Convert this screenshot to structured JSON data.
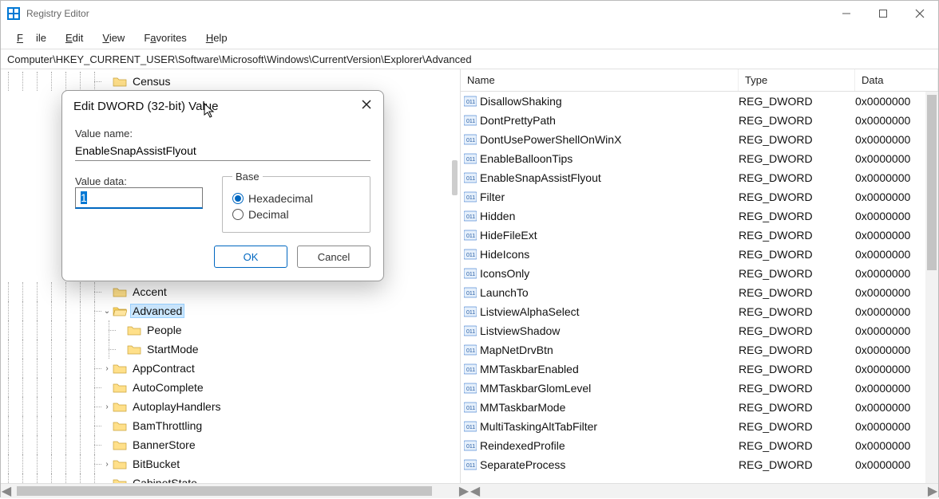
{
  "window": {
    "title": "Registry Editor"
  },
  "menu": {
    "file": "File",
    "edit": "Edit",
    "view": "View",
    "favorites": "Favorites",
    "help": "Help"
  },
  "addressbar": "Computer\\HKEY_CURRENT_USER\\Software\\Microsoft\\Windows\\CurrentVersion\\Explorer\\Advanced",
  "tree": {
    "items": [
      {
        "indent": 7,
        "exp": "",
        "label": "Census"
      },
      {
        "indent": 7,
        "exp": "",
        "label": "Accent"
      },
      {
        "indent": 7,
        "exp": "v",
        "label": "Advanced",
        "selected": true,
        "open": true
      },
      {
        "indent": 8,
        "exp": "",
        "label": "People"
      },
      {
        "indent": 8,
        "exp": "",
        "label": "StartMode"
      },
      {
        "indent": 7,
        "exp": ">",
        "label": "AppContract"
      },
      {
        "indent": 7,
        "exp": "",
        "label": "AutoComplete"
      },
      {
        "indent": 7,
        "exp": ">",
        "label": "AutoplayHandlers"
      },
      {
        "indent": 7,
        "exp": "",
        "label": "BamThrottling"
      },
      {
        "indent": 7,
        "exp": "",
        "label": "BannerStore"
      },
      {
        "indent": 7,
        "exp": ">",
        "label": "BitBucket"
      },
      {
        "indent": 7,
        "exp": "",
        "label": "CabinetState"
      }
    ]
  },
  "list": {
    "headers": {
      "name": "Name",
      "type": "Type",
      "data": "Data"
    },
    "rows": [
      {
        "name": "DisallowShaking",
        "type": "REG_DWORD",
        "data": "0x0000000"
      },
      {
        "name": "DontPrettyPath",
        "type": "REG_DWORD",
        "data": "0x0000000"
      },
      {
        "name": "DontUsePowerShellOnWinX",
        "type": "REG_DWORD",
        "data": "0x0000000"
      },
      {
        "name": "EnableBalloonTips",
        "type": "REG_DWORD",
        "data": "0x0000000"
      },
      {
        "name": "EnableSnapAssistFlyout",
        "type": "REG_DWORD",
        "data": "0x0000000"
      },
      {
        "name": "Filter",
        "type": "REG_DWORD",
        "data": "0x0000000"
      },
      {
        "name": "Hidden",
        "type": "REG_DWORD",
        "data": "0x0000000"
      },
      {
        "name": "HideFileExt",
        "type": "REG_DWORD",
        "data": "0x0000000"
      },
      {
        "name": "HideIcons",
        "type": "REG_DWORD",
        "data": "0x0000000"
      },
      {
        "name": "IconsOnly",
        "type": "REG_DWORD",
        "data": "0x0000000"
      },
      {
        "name": "LaunchTo",
        "type": "REG_DWORD",
        "data": "0x0000000"
      },
      {
        "name": "ListviewAlphaSelect",
        "type": "REG_DWORD",
        "data": "0x0000000"
      },
      {
        "name": "ListviewShadow",
        "type": "REG_DWORD",
        "data": "0x0000000"
      },
      {
        "name": "MapNetDrvBtn",
        "type": "REG_DWORD",
        "data": "0x0000000"
      },
      {
        "name": "MMTaskbarEnabled",
        "type": "REG_DWORD",
        "data": "0x0000000"
      },
      {
        "name": "MMTaskbarGlomLevel",
        "type": "REG_DWORD",
        "data": "0x0000000"
      },
      {
        "name": "MMTaskbarMode",
        "type": "REG_DWORD",
        "data": "0x0000000"
      },
      {
        "name": "MultiTaskingAltTabFilter",
        "type": "REG_DWORD",
        "data": "0x0000000"
      },
      {
        "name": "ReindexedProfile",
        "type": "REG_DWORD",
        "data": "0x0000000"
      },
      {
        "name": "SeparateProcess",
        "type": "REG_DWORD",
        "data": "0x0000000"
      }
    ]
  },
  "dialog": {
    "title": "Edit DWORD (32-bit) Value",
    "value_name_label": "Value name:",
    "value_name": "EnableSnapAssistFlyout",
    "value_data_label": "Value data:",
    "value_data": "1",
    "base_label": "Base",
    "hex_label": "Hexadecimal",
    "dec_label": "Decimal",
    "base_selected": "hex",
    "ok": "OK",
    "cancel": "Cancel"
  }
}
